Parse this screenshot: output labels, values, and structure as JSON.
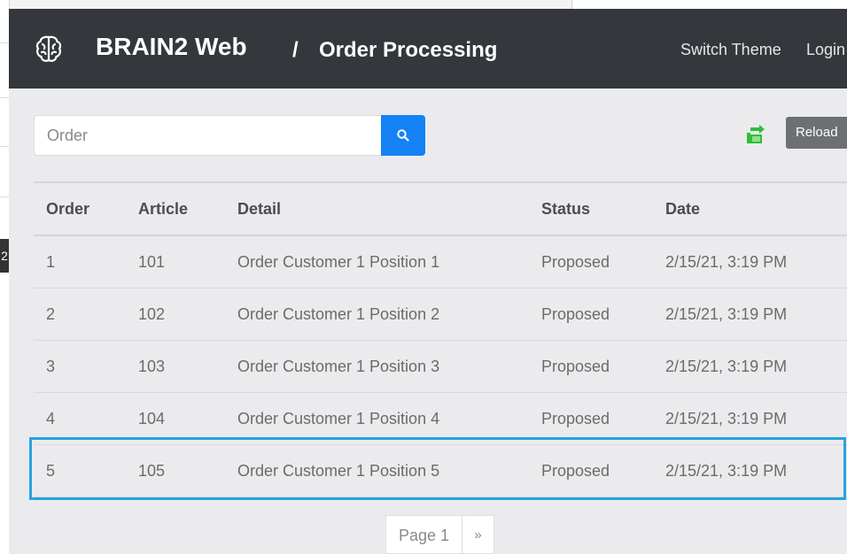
{
  "background_window": {
    "tab_text": "2"
  },
  "navbar": {
    "brand_icon": "brain-icon",
    "brand": "BRAIN2 Web",
    "separator": "/",
    "title": "Order Processing",
    "links": [
      "Switch Theme",
      "Login"
    ]
  },
  "search": {
    "placeholder": "Order",
    "value": "",
    "icon": "search-icon"
  },
  "toolbar": {
    "export_icon": "export-arrows-icon",
    "reload_label": "Reload"
  },
  "table": {
    "headers": [
      "Order",
      "Article",
      "Detail",
      "Status",
      "Date"
    ],
    "rows": [
      [
        "1",
        "101",
        "Order Customer 1 Position 1",
        "Proposed",
        "2/15/21, 3:19 PM"
      ],
      [
        "2",
        "102",
        "Order Customer 1 Position 2",
        "Proposed",
        "2/15/21, 3:19 PM"
      ],
      [
        "3",
        "103",
        "Order Customer 1 Position 3",
        "Proposed",
        "2/15/21, 3:19 PM"
      ],
      [
        "4",
        "104",
        "Order Customer 1 Position 4",
        "Proposed",
        "2/15/21, 3:19 PM"
      ],
      [
        "5",
        "105",
        "Order Customer 1 Position 5",
        "Proposed",
        "2/15/21, 3:19 PM"
      ]
    ],
    "selected_row": 5
  },
  "pagination": {
    "page_label": "Page 1",
    "next_label": "»"
  },
  "colors": {
    "navbar": "#34373c",
    "accent": "#1482f5",
    "selection": "#27a3de",
    "export_icon": "#2fbf3a",
    "reload_button": "#6c6f74"
  }
}
